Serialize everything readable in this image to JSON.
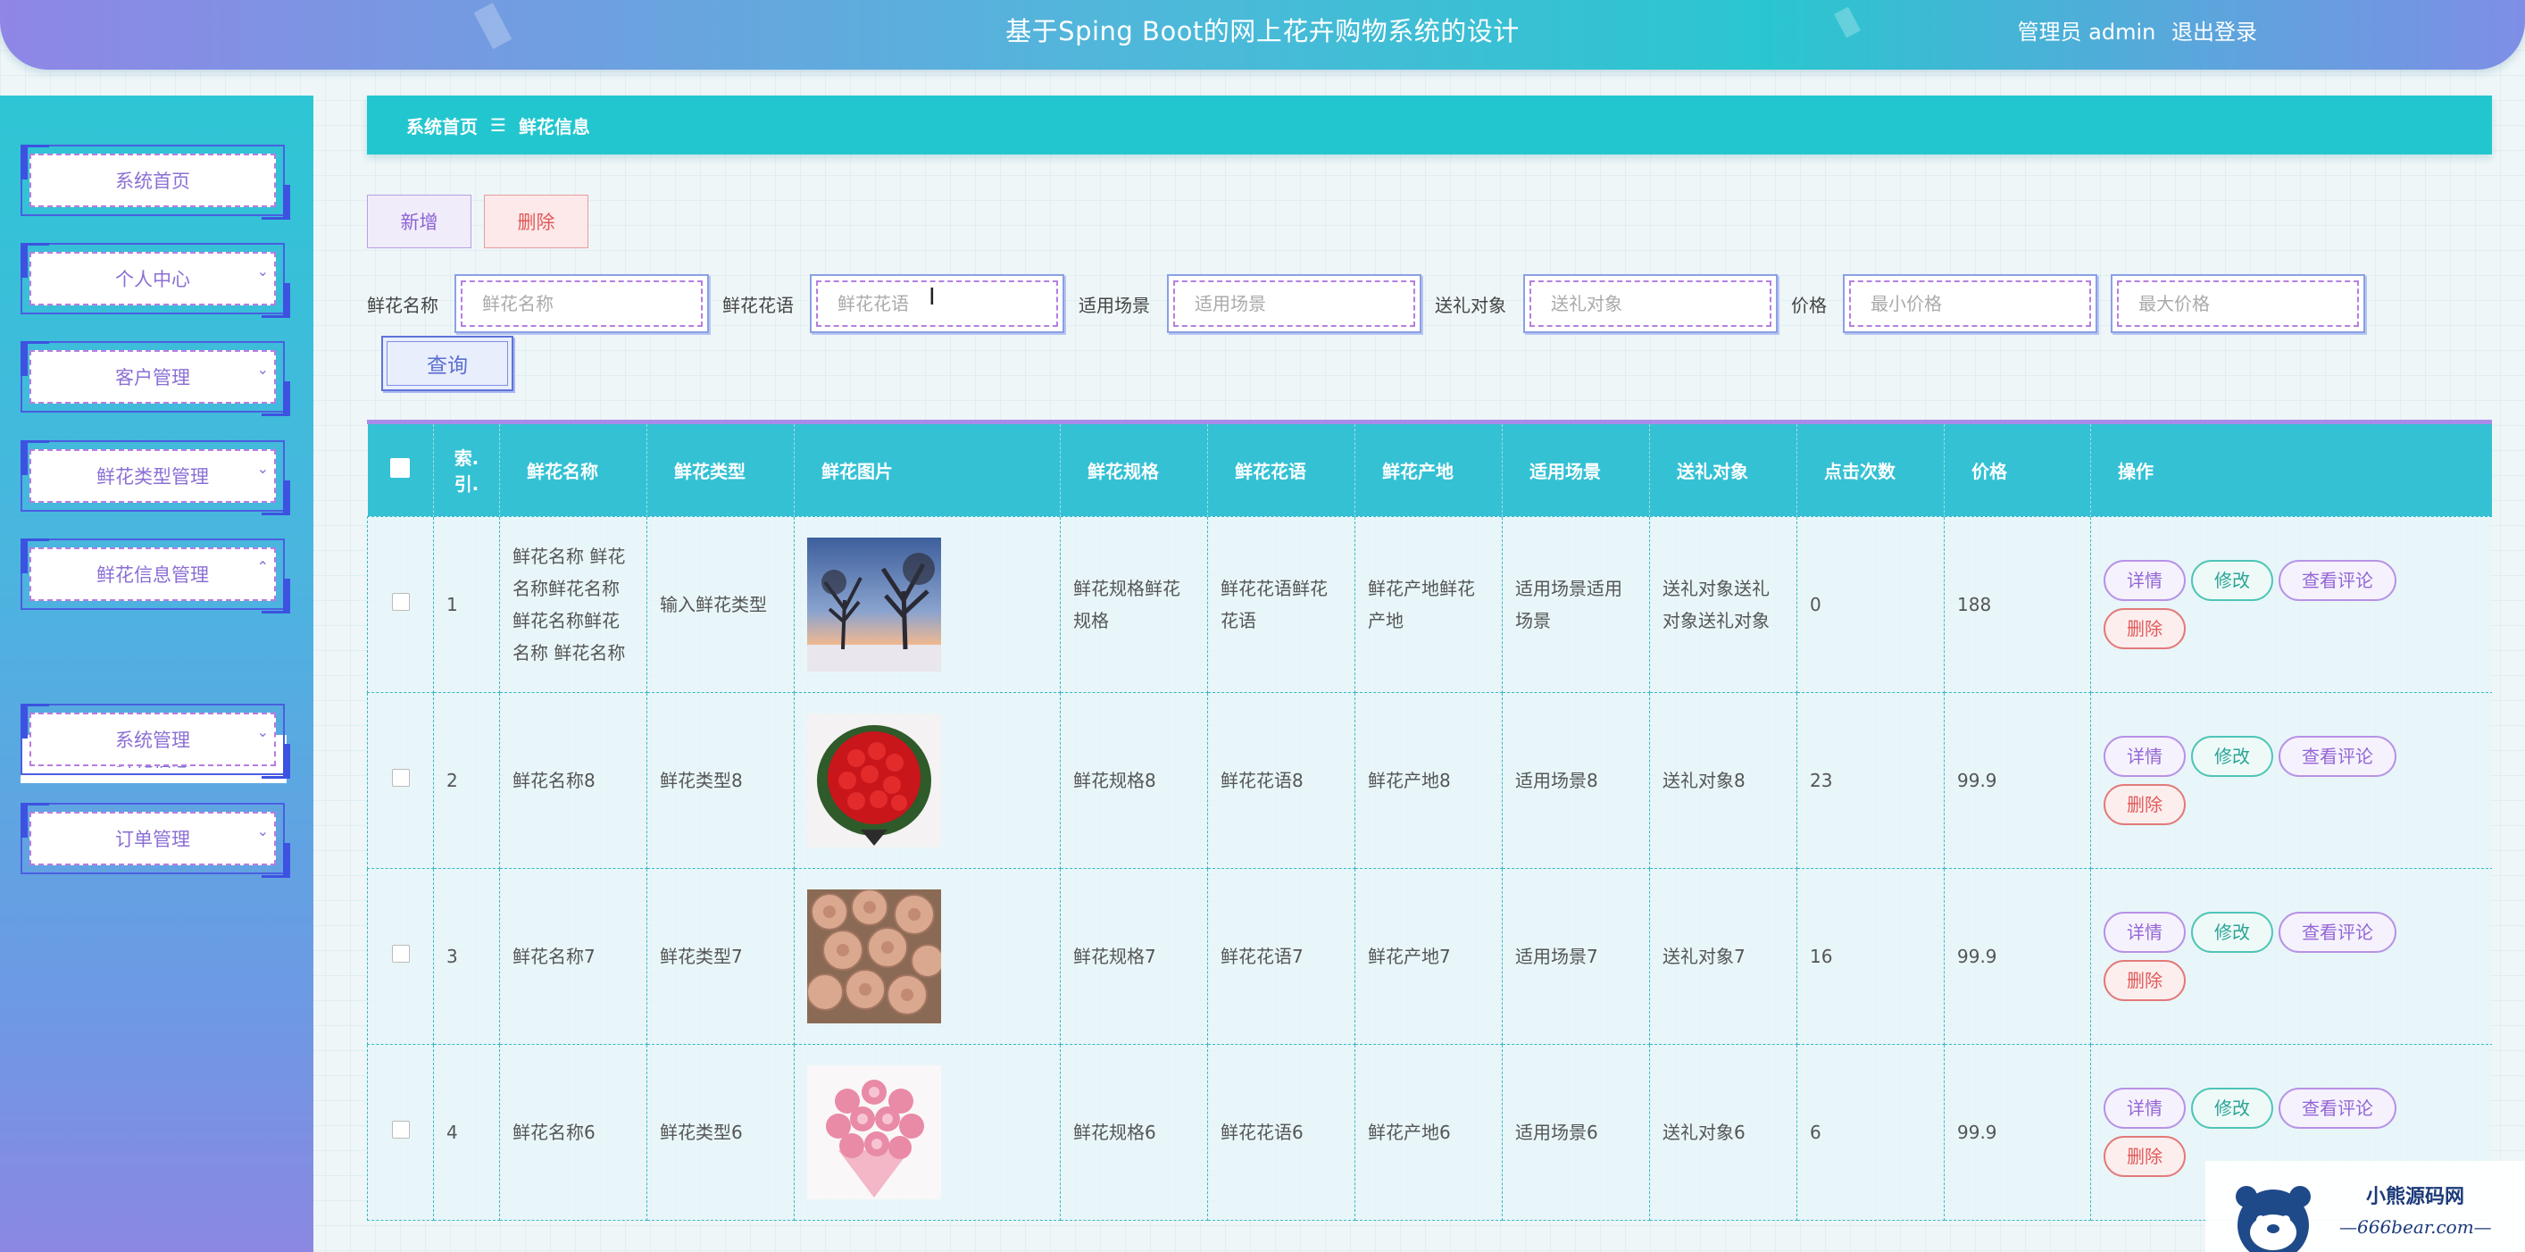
{
  "header": {
    "title": "基于Sping Boot的网上花卉购物系统的设计",
    "user_label": "管理员 admin",
    "logout_label": "退出登录"
  },
  "sidebar": {
    "items": [
      {
        "label": "系统首页",
        "has_chevron": false
      },
      {
        "label": "个人中心",
        "has_chevron": true,
        "chevron": "⌄"
      },
      {
        "label": "客户管理",
        "has_chevron": true,
        "chevron": "⌄"
      },
      {
        "label": "鲜花类型管理",
        "has_chevron": true,
        "chevron": "⌄"
      },
      {
        "label": "鲜花信息管理",
        "has_chevron": true,
        "chevron": "⌃"
      },
      {
        "label": "系统管理",
        "has_chevron": true,
        "chevron": "⌄"
      },
      {
        "label": "订单管理",
        "has_chevron": true,
        "chevron": "⌄"
      }
    ],
    "submenu": {
      "label": "鲜花信息"
    }
  },
  "breadcrumb": {
    "home": "系统首页",
    "separator": "☰",
    "current": "鲜花信息"
  },
  "actions": {
    "add_label": "新增",
    "delete_label": "删除"
  },
  "search": {
    "name_label": "鲜花名称",
    "name_placeholder": "鲜花名称",
    "lang_label": "鲜花花语",
    "lang_placeholder": "鲜花花语",
    "scene_label": "适用场景",
    "scene_placeholder": "适用场景",
    "target_label": "送礼对象",
    "target_placeholder": "送礼对象",
    "price_label": "价格",
    "min_placeholder": "最小价格",
    "max_placeholder": "最大价格",
    "search_button": "查询"
  },
  "table": {
    "columns": [
      "索.\n引.",
      "鲜花名称",
      "鲜花类型",
      "鲜花图片",
      "鲜花规格",
      "鲜花花语",
      "鲜花产地",
      "适用场景",
      "送礼对象",
      "点击次数",
      "价格",
      "操作"
    ],
    "col_index_line1": "索.",
    "col_index_line2": "引.",
    "ops": {
      "detail": "详情",
      "edit": "修改",
      "comment": "查看评论",
      "delete": "删除"
    },
    "rows": [
      {
        "index": "1",
        "name": "鲜花名称 鲜花名称鲜花名称鲜花名称鲜花名称 鲜花名称",
        "type": "输入鲜花类型",
        "image": "sunset-trees-photo",
        "spec": "鲜花规格鲜花规格",
        "lang": "鲜花花语鲜花花语",
        "origin": "鲜花产地鲜花产地",
        "scene": "适用场景适用场景",
        "target": "送礼对象送礼对象送礼对象",
        "clicks": "0",
        "price": "188"
      },
      {
        "index": "2",
        "name": "鲜花名称8",
        "type": "鲜花类型8",
        "image": "red-roses-bouquet-photo",
        "spec": "鲜花规格8",
        "lang": "鲜花花语8",
        "origin": "鲜花产地8",
        "scene": "适用场景8",
        "target": "送礼对象8",
        "clicks": "23",
        "price": "99.9"
      },
      {
        "index": "3",
        "name": "鲜花名称7",
        "type": "鲜花类型7",
        "image": "champagne-roses-photo",
        "spec": "鲜花规格7",
        "lang": "鲜花花语7",
        "origin": "鲜花产地7",
        "scene": "适用场景7",
        "target": "送礼对象7",
        "clicks": "16",
        "price": "99.9"
      },
      {
        "index": "4",
        "name": "鲜花名称6",
        "type": "鲜花类型6",
        "image": "pink-carnations-photo",
        "spec": "鲜花规格6",
        "lang": "鲜花花语6",
        "origin": "鲜花产地6",
        "scene": "适用场景6",
        "target": "送礼对象6",
        "clicks": "6",
        "price": "99.9"
      }
    ]
  },
  "watermark": {
    "line1": "小熊源码网",
    "line2": "—666bear.com—"
  },
  "colors": {
    "accent": "#22c6cf",
    "purple": "#8b6fd4",
    "danger": "#e05a5a"
  }
}
